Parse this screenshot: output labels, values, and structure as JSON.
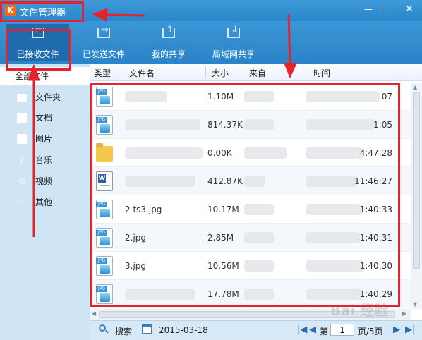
{
  "window": {
    "title": "文件管理器",
    "logo": "K",
    "controls": {
      "minimize": "—",
      "maximize": "",
      "close": "✕"
    }
  },
  "toolbar": {
    "items": [
      {
        "label": "已接收文件",
        "icon": "inbox-download-icon",
        "active": true
      },
      {
        "label": "已发送文件",
        "icon": "send-file-icon",
        "active": false
      },
      {
        "label": "我的共享",
        "icon": "upload-share-icon",
        "active": false
      },
      {
        "label": "局域网共享",
        "icon": "lan-download-icon",
        "active": false
      }
    ]
  },
  "sidebar": {
    "items": [
      {
        "label": "全部文件",
        "icon": "",
        "active": true
      },
      {
        "label": "文件夹",
        "icon": "folder-icon",
        "active": false
      },
      {
        "label": "文档",
        "icon": "document-icon",
        "active": false
      },
      {
        "label": "图片",
        "icon": "image-icon",
        "active": false
      },
      {
        "label": "音乐",
        "icon": "music-note-icon",
        "active": false
      },
      {
        "label": "视频",
        "icon": "video-play-icon",
        "active": false
      },
      {
        "label": "其他",
        "icon": "more-dots-icon",
        "active": false
      }
    ]
  },
  "table": {
    "columns": [
      "类型",
      "文件名",
      "大小",
      "来自",
      "时间"
    ],
    "rows": [
      {
        "type": "jpg",
        "name": "",
        "size": "1.10M",
        "from": "",
        "time": "07"
      },
      {
        "type": "jpg",
        "name": "",
        "size": "814.37K",
        "from": "",
        "time": "1:05"
      },
      {
        "type": "folder",
        "name": "",
        "size": "0.00K",
        "from": "",
        "time": "4:47:28"
      },
      {
        "type": "word",
        "name": "",
        "size": "412.87K",
        "from": "",
        "time": "11:46:27"
      },
      {
        "type": "jpg",
        "name": "2 ts3.jpg",
        "size": "10.17M",
        "from": "",
        "time": "1:40:33"
      },
      {
        "type": "jpg",
        "name": "2.jpg",
        "size": "2.85M",
        "from": "",
        "time": "1:40:31"
      },
      {
        "type": "jpg",
        "name": "3.jpg",
        "size": "10.56M",
        "from": "",
        "time": "1:40:30"
      },
      {
        "type": "jpg",
        "name": "",
        "size": "17.78M",
        "from": "",
        "time": "1:40:29"
      }
    ]
  },
  "bottombar": {
    "search_label": "搜索",
    "date": "2015-03-18",
    "page_prefix": "第",
    "page_current": "1",
    "page_total": "页/5页"
  },
  "watermark": "Bai 经验",
  "colors": {
    "titlebar": "#2a86cc",
    "sidebar": "#cfe4f4",
    "annotation": "#e5232e"
  }
}
